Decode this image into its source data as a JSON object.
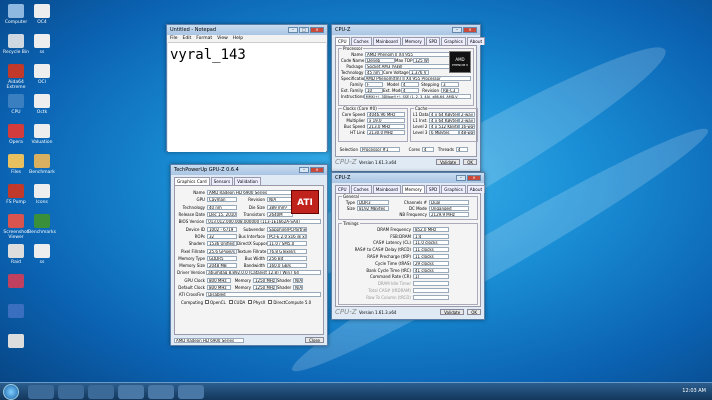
{
  "desktop": {
    "icons_left": [
      {
        "label": "Computer",
        "color": "#8fb8e0"
      },
      {
        "label": "Recycle Bin",
        "color": "#cfd8e0"
      },
      {
        "label": "Aida64 Extreme",
        "color": "#c0392b"
      },
      {
        "label": "CPU",
        "color": "#3a7fbf"
      },
      {
        "label": "Opera",
        "color": "#d23c3c"
      },
      {
        "label": "Files",
        "color": "#e8c060"
      },
      {
        "label": "FS Pump",
        "color": "#c0392b"
      },
      {
        "label": "Screenshot Viewer",
        "color": "#d9534f"
      },
      {
        "label": "Raid",
        "color": "#dddddd"
      },
      {
        "label": "",
        "color": "#c04060"
      },
      {
        "label": "",
        "color": "#3a6fbf"
      },
      {
        "label": "",
        "color": "#dddddd"
      }
    ],
    "icons_right": [
      {
        "label": "OC4",
        "color": "#eeeeee"
      },
      {
        "label": "ss",
        "color": "#eeeeee"
      },
      {
        "label": "OCI",
        "color": "#eeeeee"
      },
      {
        "label": "Octk",
        "color": "#eeeeee"
      },
      {
        "label": "Valuation",
        "color": "#eeeeee"
      },
      {
        "label": "Benchmark",
        "color": "#d9b060"
      },
      {
        "label": "Icons",
        "color": "#eeeeee"
      },
      {
        "label": "Benchmarks",
        "color": "#3a8f3a"
      },
      {
        "label": "ss",
        "color": "#eeeeee"
      }
    ]
  },
  "notepad": {
    "title": "Untitled - Notepad",
    "menu": [
      "File",
      "Edit",
      "Format",
      "View",
      "Help"
    ],
    "text": "vyral_143"
  },
  "cpuz_cpu": {
    "title": "CPU-Z",
    "tabs": [
      "CPU",
      "Caches",
      "Mainboard",
      "Memory",
      "SPD",
      "Graphics",
      "About"
    ],
    "active_tab": "CPU",
    "processor_label": "Processor",
    "name_key": "Name",
    "name": "AMD Phenom II X4 955",
    "codename_key": "Code Name",
    "codename": "Deneb",
    "maxtdp_key": "Max TDP",
    "maxtdp": "125 W",
    "package_key": "Package",
    "package": "Socket AM3 (938)",
    "tech_key": "Technology",
    "tech": "45 nm",
    "voltage_key": "Core Voltage",
    "voltage": "1.376 V",
    "spec_key": "Specification",
    "spec": "AMD Phenom(tm) II X4 955 Processor",
    "family_key": "Family",
    "family": "F",
    "model_key": "Model",
    "model": "4",
    "stepping_key": "Stepping",
    "stepping": "3",
    "extfam_key": "Ext. Family",
    "extfam": "10",
    "extmodel_key": "Ext. Model",
    "extmodel": "4",
    "rev_key": "Revision",
    "rev": "RB-C3",
    "instr_key": "Instructions",
    "instr": "MMX(+), 3DNow!(+), SSE (1, 2, 3, 4A), x86-64, AMD-V",
    "clocks_label": "Clocks (Core #0)",
    "cache_label": "Cache",
    "corespeed_key": "Core Speed",
    "corespeed": "4046.96 MHz",
    "l1d_key": "L1 Data",
    "l1d": "4 x 64 KBytes",
    "l1d_w": "2-way",
    "mult_key": "Multiplier",
    "mult": "x 19.0",
    "l1i_key": "L1 Inst.",
    "l1i": "4 x 64 KBytes",
    "l1i_w": "2-way",
    "bus_key": "Bus Speed",
    "bus": "213.0 MHz",
    "l2_key": "Level 2",
    "l2": "4 x 512 KBytes",
    "l2_w": "16-way",
    "ht_key": "HT Link",
    "ht": "2130.0 MHz",
    "l3_key": "Level 3",
    "l3": "6 MBytes",
    "l3_w": "48-way",
    "sel_key": "Selection",
    "sel": "Processor #1",
    "cores_key": "Cores",
    "cores": "4",
    "threads_key": "Threads",
    "threads": "4",
    "brand": "CPU-Z",
    "version": "Version 1.61.3.x64",
    "validate": "Validate",
    "ok": "OK",
    "logo_brand": "AMD",
    "logo_sub": "PHENOM II"
  },
  "gpuz": {
    "title": "TechPowerUp GPU-Z 0.6.4",
    "tabs": [
      "Graphics Card",
      "Sensors",
      "Validation"
    ],
    "logo": "ATI",
    "rows": [
      {
        "k": "Name",
        "v": "AMD Radeon HD 6900 Series"
      },
      {
        "k": "GPU",
        "v": "Cayman",
        "k2": "Revision",
        "v2": "N/A"
      },
      {
        "k": "Technology",
        "v": "40 nm",
        "k2": "Die Size",
        "v2": "389 mm²"
      },
      {
        "k": "Release Date",
        "v": "Dec 15, 2010",
        "k2": "Transistors",
        "v2": "2640M"
      },
      {
        "k": "BIOS Version",
        "v": "013.012.000.008.000000 (113-1E1662A-SA4)"
      },
      {
        "k": "Device ID",
        "v": "1002 - 6719",
        "k2": "Subvendor",
        "v2": "Sapphire/PCPartner (174B)"
      },
      {
        "k": "ROPs",
        "v": "32",
        "k2": "Bus Interface",
        "v2": "PCI-E 2.0 x16 @ x4 2.0"
      },
      {
        "k": "Shaders",
        "v": "1536 Unified",
        "k2": "DirectX Support",
        "v2": "11.0 / SM5.0"
      },
      {
        "k": "Pixel Fillrate",
        "v": "25.6 GPixel/s",
        "k2": "Texture Fillrate",
        "v2": "76.8 GTexel/s"
      },
      {
        "k": "Memory Type",
        "v": "GDDR5",
        "k2": "Bus Width",
        "v2": "256 Bit"
      },
      {
        "k": "Memory Size",
        "v": "2048 MB",
        "k2": "Bandwidth",
        "v2": "160.0 GB/s"
      },
      {
        "k": "Driver Version",
        "v": "atiumdag 8.892.0.0 (Catalyst 12.8) / Win7 64"
      },
      {
        "k": "GPU Clock",
        "v": "800 MHz",
        "k2": "Memory",
        "v2": "1250 MHz",
        "k3": "Shader",
        "v3": "N/A"
      },
      {
        "k": "Default Clock",
        "v": "800 MHz",
        "k2": "Memory",
        "v2": "1250 MHz",
        "k3": "Shader",
        "v3": "N/A"
      },
      {
        "k": "ATI CrossFire",
        "v": "Disabled"
      }
    ],
    "computing_label": "Computing",
    "computing": [
      "OpenCL",
      "CUDA",
      "PhysX",
      "DirectCompute 5.0"
    ],
    "select": "AMD Radeon HD 6900 Series",
    "close": "Close"
  },
  "cpuz_mem": {
    "title": "CPU-Z",
    "tabs": [
      "CPU",
      "Caches",
      "Mainboard",
      "Memory",
      "SPD",
      "Graphics",
      "About"
    ],
    "active_tab": "Memory",
    "general_label": "General",
    "type_key": "Type",
    "type": "DDR3",
    "channel_key": "Channels #",
    "channel": "Dual",
    "size_key": "Size",
    "size": "8192 MBytes",
    "dcmode_key": "DC Mode",
    "dcmode": "Unganged",
    "nbfreq_key": "NB Frequency",
    "nbfreq": "2129.9 MHz",
    "timings_label": "Timings",
    "timings": [
      {
        "k": "DRAM Frequency",
        "v": "852.0 MHz"
      },
      {
        "k": "FSB:DRAM",
        "v": "1:4"
      },
      {
        "k": "CAS# Latency (CL)",
        "v": "11.0 clocks"
      },
      {
        "k": "RAS# to CAS# Delay (tRCD)",
        "v": "11 clocks"
      },
      {
        "k": "RAS# Precharge (tRP)",
        "v": "11 clocks"
      },
      {
        "k": "Cycle Time (tRAS)",
        "v": "29 clocks"
      },
      {
        "k": "Bank Cycle Time (tRC)",
        "v": "41 clocks"
      },
      {
        "k": "Command Rate (CR)",
        "v": "1T"
      },
      {
        "k": "DRAM Idle Timer",
        "v": ""
      },
      {
        "k": "Total CAS# (tRDRAM)",
        "v": ""
      },
      {
        "k": "Row To Column (tRCD)",
        "v": ""
      }
    ],
    "brand": "CPU-Z",
    "version": "Version 1.61.3.x64",
    "validate": "Validate",
    "ok": "OK"
  },
  "taskbar": {
    "time": "12:03 AM"
  }
}
